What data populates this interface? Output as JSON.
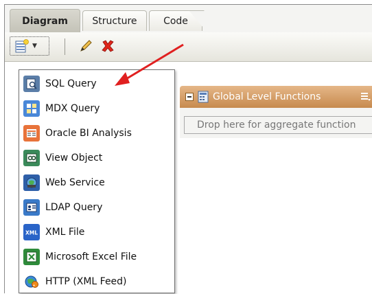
{
  "tabs": [
    {
      "label": "Diagram",
      "active": true
    },
    {
      "label": "Structure",
      "active": false
    },
    {
      "label": "Code",
      "active": false
    }
  ],
  "toolbar": {
    "new_icon": "new-data-set-icon",
    "dropdown_icon": "chevron-down-icon",
    "edit_icon": "pencil-icon",
    "delete_icon": "red-x-icon"
  },
  "menu": {
    "items": [
      {
        "label": "SQL Query",
        "icon": "sql-query-icon"
      },
      {
        "label": "MDX Query",
        "icon": "mdx-query-icon"
      },
      {
        "label": "Oracle BI Analysis",
        "icon": "oracle-bi-icon"
      },
      {
        "label": "View Object",
        "icon": "view-object-icon"
      },
      {
        "label": "Web Service",
        "icon": "web-service-icon"
      },
      {
        "label": "LDAP Query",
        "icon": "ldap-query-icon"
      },
      {
        "label": "XML File",
        "icon": "xml-file-icon"
      },
      {
        "label": "Microsoft Excel File",
        "icon": "excel-file-icon"
      },
      {
        "label": "HTTP (XML Feed)",
        "icon": "http-feed-icon"
      }
    ]
  },
  "panel": {
    "title": "Global Level Functions",
    "drop_placeholder": "Drop here for aggregate function"
  },
  "annotation": {
    "arrow_color": "#e02020"
  },
  "colors": {
    "panel_header": "#c78a4e",
    "active_tab": "#c4c3b8"
  }
}
